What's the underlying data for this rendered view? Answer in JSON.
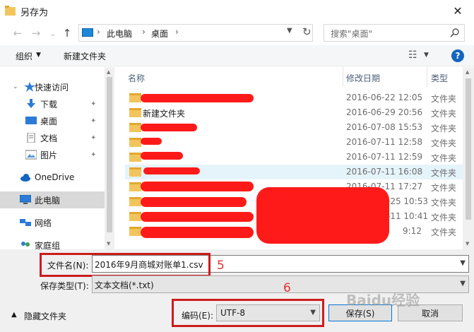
{
  "window": {
    "title": "另存为",
    "close_glyph": "✕"
  },
  "nav": {
    "back_glyph": "←",
    "forward_glyph": "→",
    "recent_glyph": "⌄",
    "up_glyph": "↑",
    "breadcrumb": [
      "此电脑",
      "桌面"
    ],
    "separator": "›",
    "search_placeholder": "搜索\"桌面\""
  },
  "toolbar": {
    "organize": "组织",
    "new_folder": "新建文件夹",
    "view_glyph": "☷"
  },
  "sidebar": {
    "items": [
      {
        "label": "快速访问",
        "icon": "star-icon",
        "pinned": false
      },
      {
        "label": "下载",
        "icon": "download-icon",
        "pinned": true
      },
      {
        "label": "桌面",
        "icon": "desktop-icon",
        "pinned": true
      },
      {
        "label": "文档",
        "icon": "document-icon",
        "pinned": true
      },
      {
        "label": "图片",
        "icon": "pictures-icon",
        "pinned": true
      },
      {
        "label": "OneDrive",
        "icon": "cloud-icon",
        "pinned": false
      },
      {
        "label": "此电脑",
        "icon": "computer-icon",
        "pinned": false
      },
      {
        "label": "网络",
        "icon": "network-icon",
        "pinned": false
      },
      {
        "label": "家庭组",
        "icon": "homegroup-icon",
        "pinned": false
      }
    ],
    "pin_glyph": "📌"
  },
  "columns": {
    "name": "名称",
    "modified": "修改日期",
    "type": "类型"
  },
  "files": [
    {
      "name": "",
      "modified": "2016-06-22 12:05",
      "type": "文件夹"
    },
    {
      "name": "新建文件夹",
      "modified": "2016-06-29 20:56",
      "type": "文件夹"
    },
    {
      "name": "",
      "modified": "2016-07-08 15:53",
      "type": "文件夹"
    },
    {
      "name": "",
      "modified": "2016-07-11 12:58",
      "type": "文件夹"
    },
    {
      "name": "",
      "modified": "2016-07-11 12:59",
      "type": "文件夹"
    },
    {
      "name": "",
      "modified": "2016-07-11 16:08",
      "type": "文件夹"
    },
    {
      "name": "",
      "modified": "2016-07-11 17:27",
      "type": "文件夹"
    },
    {
      "name": "",
      "modified": "-25 10:53",
      "type": "文件夹"
    },
    {
      "name": "",
      "modified": "-11 10:41",
      "type": "文件夹"
    },
    {
      "name": "",
      "modified": "9:12",
      "type": "文件夹"
    }
  ],
  "form": {
    "filename_label": "文件名(N):",
    "filename_value": "2016年9月商城对账单1.csv",
    "filetype_label": "保存类型(T):",
    "filetype_value": "文本文档(*.txt)",
    "encoding_label": "编码(E):",
    "encoding_value": "UTF-8",
    "hide_folders": "隐藏文件夹",
    "save": "保存(S)",
    "cancel": "取消"
  },
  "annotations": {
    "step5": "5",
    "step6": "6",
    "accent_red": "#cc1c1c"
  },
  "watermark": "Baidu经验"
}
